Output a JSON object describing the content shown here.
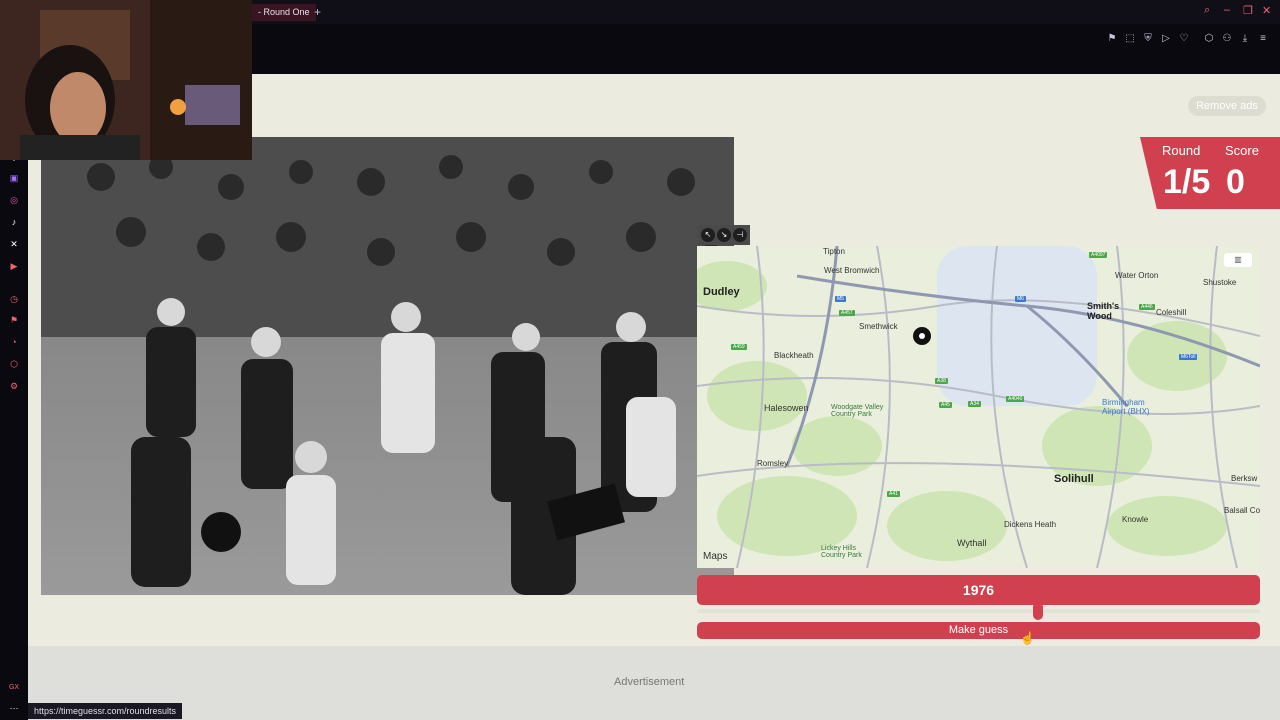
{
  "browser": {
    "tab_title": "- Round One",
    "tab_add": "+",
    "status_url": "https://timeguessr.com/roundresults"
  },
  "page": {
    "remove_ads": "Remove ads",
    "round_label": "Round",
    "round_value": "1/5",
    "score_label": "Score",
    "score_value": "0",
    "year": "1976",
    "make_guess": "Make guess",
    "advertisement": "Advertisement"
  },
  "map": {
    "attribution": "Maps",
    "places_big": [
      "Dudley",
      "Solihull"
    ],
    "places_medium": [
      "Smith's Wood"
    ],
    "places": [
      "West Bromwich",
      "Water Orton",
      "Shustoke",
      "Coleshill",
      "Smethwick",
      "Blackheath",
      "Halesowen",
      "Romsley",
      "Dickens Heath",
      "Wythall",
      "Knowle",
      "Balsall Co",
      "Berksw",
      "Tipton"
    ],
    "parks": [
      "Woodgate Valley Country Park",
      "Lickey Hills Country Park"
    ],
    "airport": "Birmingham Airport (BHX)",
    "roads": [
      "M5",
      "M6",
      "A457",
      "A459",
      "A4097",
      "A446",
      "M6Toll",
      "A38",
      "A45",
      "A34",
      "A4040",
      "A41"
    ]
  }
}
